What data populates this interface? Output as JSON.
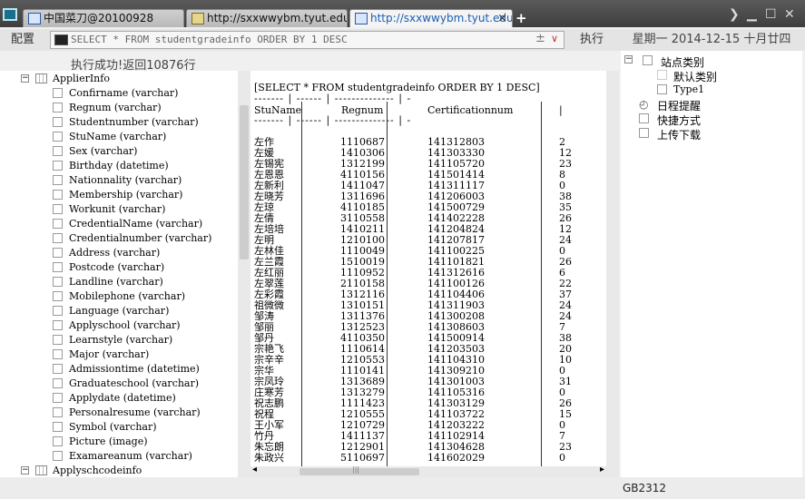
{
  "tabs": [
    {
      "label": "中国菜刀@20100928",
      "icon": "window-icon",
      "active": false
    },
    {
      "label": "http://sxxwwybm.tyut.edu.cn/...",
      "icon": "folder-icon",
      "active": false
    },
    {
      "label": "http://sxxwwybm.tyut.edu.cn/...",
      "icon": "window-icon",
      "active": true
    }
  ],
  "new_tab": "+",
  "toolbar": {
    "config_label": "配置",
    "sql": "SELECT * FROM studentgradeinfo ORDER BY 1 DESC",
    "spin": "±",
    "dropdown": "∨",
    "exec_label": "执行",
    "date": "星期一 2014-12-15 十月廿四"
  },
  "status": "执行成功!返回10876行",
  "tree": {
    "table1": "ApplierInfo",
    "fields": [
      "Confirname (varchar)",
      "Regnum (varchar)",
      "Studentnumber (varchar)",
      "StuName (varchar)",
      "Sex (varchar)",
      "Birthday (datetime)",
      "Nationnality (varchar)",
      "Membership (varchar)",
      "Workunit (varchar)",
      "CredentialName (varchar)",
      "Credentialnumber (varchar)",
      "Address (varchar)",
      "Postcode (varchar)",
      "Landline (varchar)",
      "Mobilephone (varchar)",
      "Language (varchar)",
      "Applyschool (varchar)",
      "Learnstyle (varchar)",
      "Major (varchar)",
      "Admissiontime (datetime)",
      "Graduateschool (varchar)",
      "Applydate (datetime)",
      "Personalresume (varchar)",
      "Symbol (varchar)",
      "Picture (image)",
      "Examareanum (varchar)"
    ],
    "table2": "Applyschcodeinfo"
  },
  "result": {
    "query_line": "[SELECT * FROM studentgradeinfo ORDER BY 1 DESC]",
    "separator": "------- | ------ | -------------- | -",
    "columns": [
      "StuName",
      "Regnum",
      "Certificationnum",
      "|"
    ],
    "rows": [
      [
        "左作",
        "1110687",
        "141312803",
        "2"
      ],
      [
        "左媛",
        "1410306",
        "141303330",
        "12"
      ],
      [
        "左锡宪",
        "1312199",
        "141105720",
        "23"
      ],
      [
        "左恩恩",
        "4110156",
        "141501414",
        "8"
      ],
      [
        "左新利",
        "1411047",
        "141311117",
        "0"
      ],
      [
        "左晓芳",
        "1311696",
        "141206003",
        "38"
      ],
      [
        "左琼",
        "4110185",
        "141500729",
        "35"
      ],
      [
        "左倩",
        "3110558",
        "141402228",
        "26"
      ],
      [
        "左培培",
        "1410211",
        "141204824",
        "12"
      ],
      [
        "左明",
        "1210100",
        "141207817",
        "24"
      ],
      [
        "左林佳",
        "1110049",
        "141100225",
        "0"
      ],
      [
        "左兰霞",
        "1510019",
        "141101821",
        "26"
      ],
      [
        "左红丽",
        "1110952",
        "141312616",
        "6"
      ],
      [
        "左翠莲",
        "2110158",
        "141100126",
        "22"
      ],
      [
        "左彩霞",
        "1312116",
        "141104406",
        "37"
      ],
      [
        "祖微微",
        "1310151",
        "141311903",
        "24"
      ],
      [
        "邹涛",
        "1311376",
        "141300208",
        "24"
      ],
      [
        "邹丽",
        "1312523",
        "141308603",
        "7"
      ],
      [
        "邹丹",
        "4110350",
        "141500914",
        "38"
      ],
      [
        "宗艳飞",
        "1110614",
        "141203503",
        "20"
      ],
      [
        "宗辛辛",
        "1210553",
        "141104310",
        "10"
      ],
      [
        "宗华",
        "1110141",
        "141309210",
        "0"
      ],
      [
        "宗凤玲",
        "1313689",
        "141301003",
        "31"
      ],
      [
        "庄寒芳",
        "1313279",
        "141105316",
        "0"
      ],
      [
        "祝志鹏",
        "1111423",
        "141303129",
        "26"
      ],
      [
        "祝程",
        "1210555",
        "141103722",
        "15"
      ],
      [
        "王小军",
        "1210729",
        "141203222",
        "0"
      ],
      [
        "竹丹",
        "1411137",
        "141102914",
        "7"
      ],
      [
        "朱忘朗",
        "1212901",
        "141304628",
        "23"
      ],
      [
        "朱政兴",
        "5110697",
        "141602029",
        "0"
      ]
    ]
  },
  "hscroll": {
    "left": "◂",
    "grip": "|||",
    "right": "▸"
  },
  "right_tree": {
    "root": "站点类别",
    "default_cat": "默认类别",
    "type1": "Type1",
    "schedule": "日程提醒",
    "shortcuts": "快捷方式",
    "upload": "上传下载"
  },
  "encoding": "GB2312"
}
